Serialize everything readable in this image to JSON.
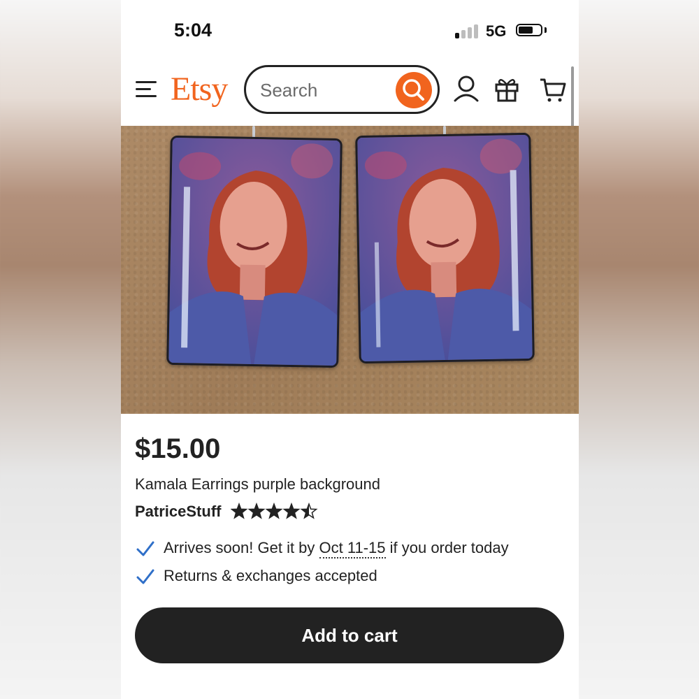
{
  "status_bar": {
    "time": "5:04",
    "network": "5G",
    "signal_bars_active": 1,
    "signal_bars_total": 4
  },
  "header": {
    "logo": "Etsy",
    "search_placeholder": "Search",
    "icons": [
      "menu-icon",
      "search-icon",
      "account-icon",
      "gift-icon",
      "cart-icon"
    ]
  },
  "product": {
    "price": "$15.00",
    "title": "Kamala Earrings purple background",
    "shop_name": "PatriceStuff",
    "rating": 4.5,
    "rating_max": 5,
    "shipping": {
      "prefix": "Arrives soon! Get it by ",
      "dates": "Oct 11-15",
      "suffix": " if you order today"
    },
    "returns": "Returns & exchanges accepted",
    "add_to_cart_label": "Add to cart"
  },
  "colors": {
    "brand": "#f1641e",
    "check": "#2f6fc8",
    "button": "#222222"
  }
}
